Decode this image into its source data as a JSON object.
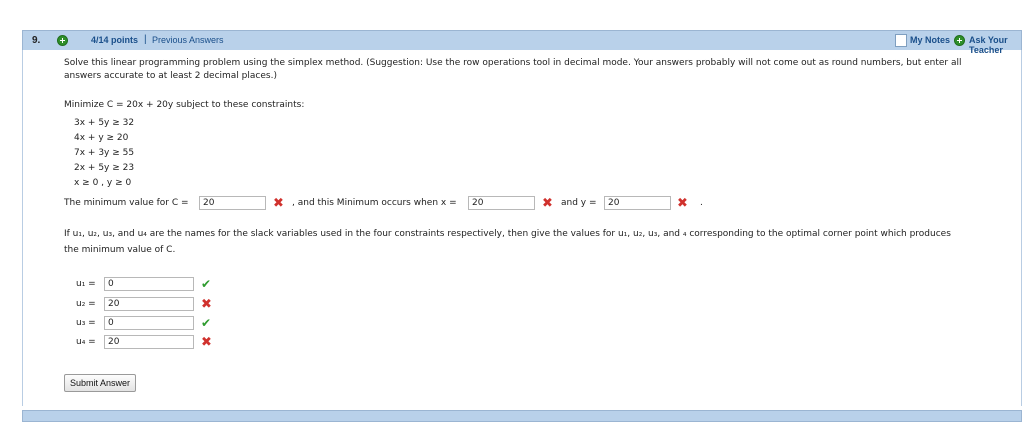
{
  "question": {
    "number": "9.",
    "points": "4/14 points",
    "separator": "|",
    "previous_answers": "Previous Answers",
    "my_notes": "My Notes",
    "ask_teacher": "Ask Your Teacher"
  },
  "problem": {
    "intro_line1": "Solve this linear programming problem using the simplex method. (Suggestion: Use the row operations tool in decimal mode. Your answers probably will not come out as round numbers, but enter all",
    "intro_line2": "answers accurate to at least 2 decimal places.)",
    "objective": "Minimize C = 20x + 20y subject to these constraints:",
    "constraints": [
      "3x + 5y ≥ 32",
      "4x + y ≥ 20",
      "7x + 3y ≥ 55",
      "2x + 5y ≥ 23",
      "x ≥ 0 , y ≥ 0"
    ]
  },
  "result_row": {
    "label_min": "The minimum value for C =",
    "min_value": "20",
    "label_x": ", and this Minimum occurs when x =",
    "x_value": "20",
    "label_y": "and y =",
    "y_value": "20",
    "end": "."
  },
  "slack": {
    "text_line1": "If u₁, u₂, u₃, and u₄ are the names for the slack variables used in the four constraints respectively, then give the values for u₁, u₂, u₃, and ₄ corresponding to the optimal corner point which produces",
    "text_line2": "the minimum value of C.",
    "rows": [
      {
        "label": "u₁ =",
        "value": "0",
        "status": "correct"
      },
      {
        "label": "u₂ =",
        "value": "20",
        "status": "incorrect"
      },
      {
        "label": "u₃ =",
        "value": "0",
        "status": "correct"
      },
      {
        "label": "u₄ =",
        "value": "20",
        "status": "incorrect"
      }
    ]
  },
  "submit_label": "Submit Answer",
  "colors": {
    "header_bg": "#b9d1ea",
    "link": "#1a4f8a",
    "correct": "#2e9b2e",
    "incorrect": "#d0312d"
  }
}
